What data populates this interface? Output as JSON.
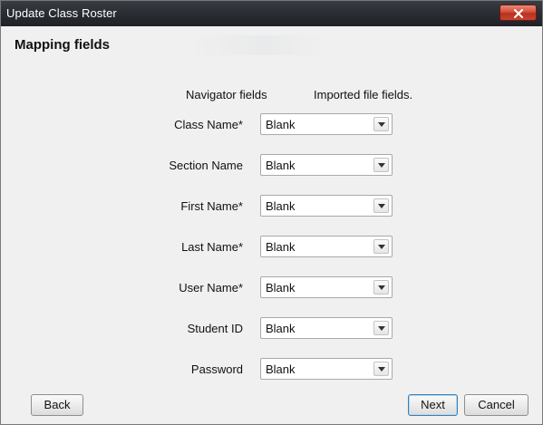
{
  "window": {
    "title": "Update Class Roster"
  },
  "page": {
    "section_title": "Mapping fields",
    "navigator_header": "Navigator fields",
    "imported_header": "Imported file fields."
  },
  "fields": [
    {
      "label": "Class Name*",
      "value": "Blank"
    },
    {
      "label": "Section Name",
      "value": "Blank"
    },
    {
      "label": "First Name*",
      "value": "Blank"
    },
    {
      "label": "Last Name*",
      "value": "Blank"
    },
    {
      "label": "User Name*",
      "value": "Blank"
    },
    {
      "label": "Student ID",
      "value": "Blank"
    },
    {
      "label": "Password",
      "value": "Blank"
    }
  ],
  "buttons": {
    "back": "Back",
    "next": "Next",
    "cancel": "Cancel"
  },
  "icons": {
    "close": "close-icon",
    "dropdown": "chevron-down-icon"
  },
  "colors": {
    "titlebar": "#2b2e34",
    "close_button": "#d2503a",
    "default_button_border": "#3c7fb1"
  }
}
